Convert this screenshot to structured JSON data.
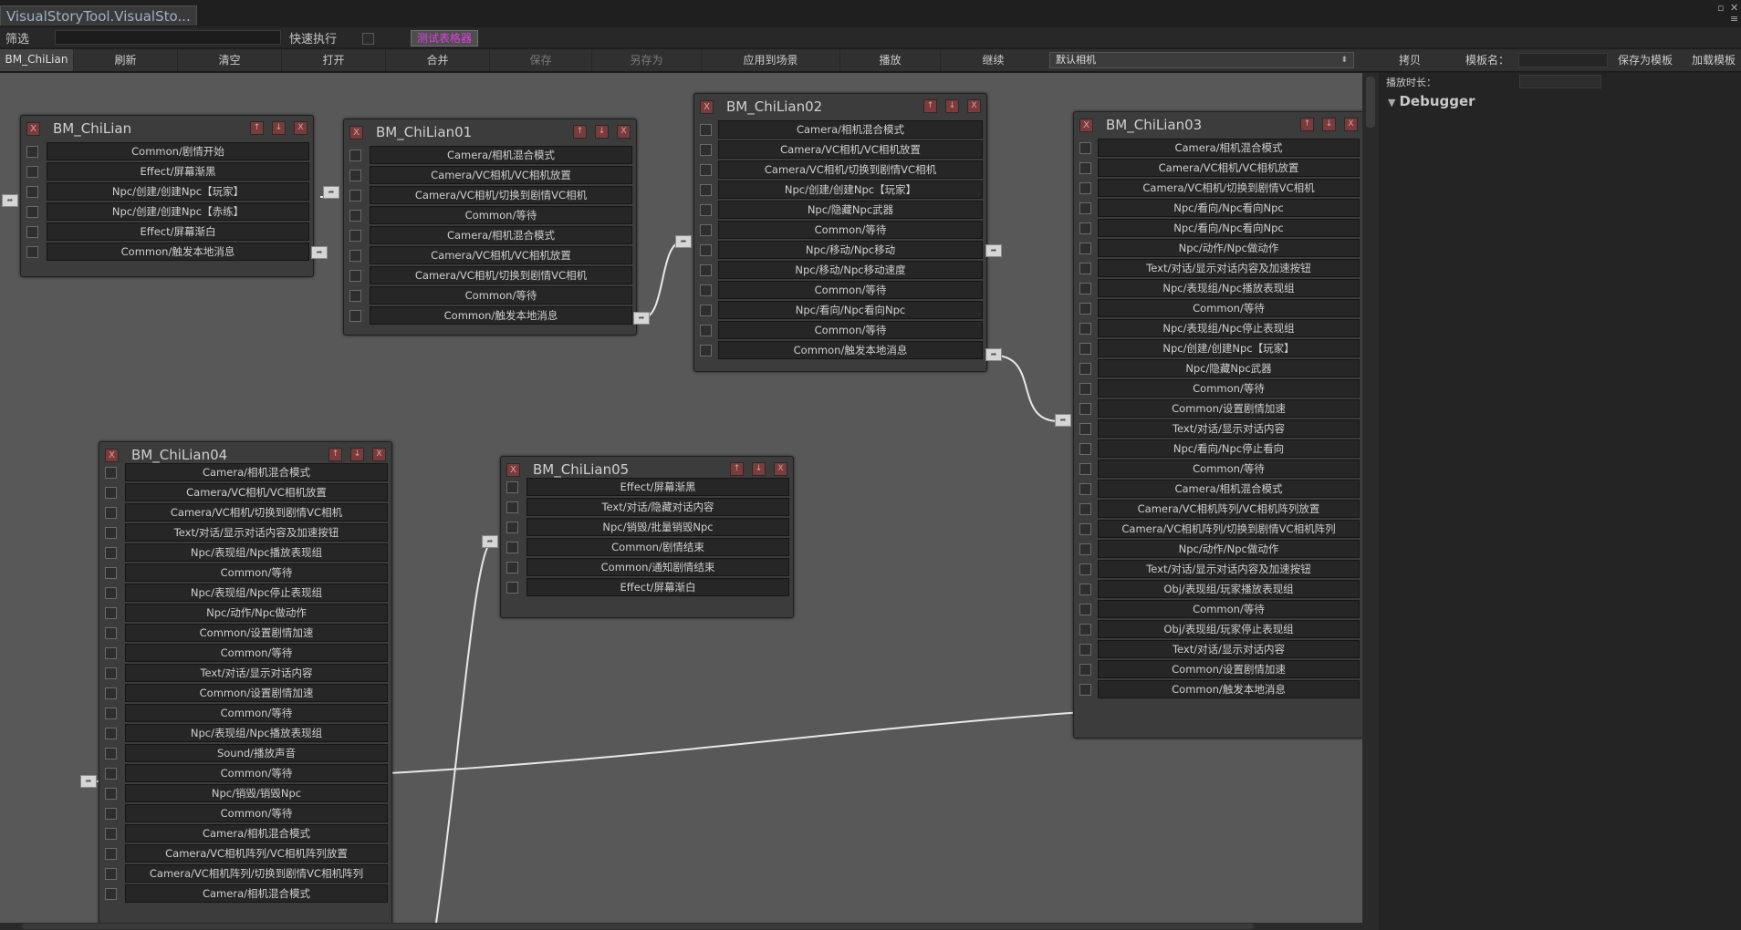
{
  "window": {
    "tab_title": "VisualStoryTool.VisualSto...",
    "controls": [
      "▫",
      "✕",
      "≡"
    ]
  },
  "filterbar": {
    "filter_label": "筛选",
    "quick_exec_label": "快速执行",
    "magenta_button": "测试表格器"
  },
  "toolbar": {
    "active_tab": "BM_ChiLian",
    "buttons": [
      "刷新",
      "清空",
      "打开",
      "合并",
      "保存",
      "另存为",
      "应用到场景",
      "播放",
      "继续"
    ],
    "camera_select": "默认相机",
    "copy_button": "拷贝",
    "template_name_label": "模板名：",
    "save_template_button": "保存为模板",
    "load_template_button": "加载模板"
  },
  "right_panel": {
    "play_duration_label": "播放时长：",
    "debugger_label": "Debugger"
  },
  "nodes": [
    {
      "title": "BM_ChiLian",
      "rows": [
        "Common/剧情开始",
        "Effect/屏幕渐黑",
        "Npc/创建/创建Npc【玩家】",
        "Npc/创建/创建Npc【赤练】",
        "Effect/屏幕渐白",
        "Common/触发本地消息"
      ]
    },
    {
      "title": "BM_ChiLian01",
      "rows": [
        "Camera/相机混合模式",
        "Camera/VC相机/VC相机放置",
        "Camera/VC相机/切换到剧情VC相机",
        "Common/等待",
        "Camera/相机混合模式",
        "Camera/VC相机/VC相机放置",
        "Camera/VC相机/切换到剧情VC相机",
        "Common/等待",
        "Common/触发本地消息"
      ]
    },
    {
      "title": "BM_ChiLian02",
      "rows": [
        "Camera/相机混合模式",
        "Camera/VC相机/VC相机放置",
        "Camera/VC相机/切换到剧情VC相机",
        "Npc/创建/创建Npc【玩家】",
        "Npc/隐藏Npc武器",
        "Common/等待",
        "Npc/移动/Npc移动",
        "Npc/移动/Npc移动速度",
        "Common/等待",
        "Npc/看向/Npc看向Npc",
        "Common/等待",
        "Common/触发本地消息"
      ]
    },
    {
      "title": "BM_ChiLian03",
      "rows": [
        "Camera/相机混合模式",
        "Camera/VC相机/VC相机放置",
        "Camera/VC相机/切换到剧情VC相机",
        "Npc/看向/Npc看向Npc",
        "Npc/看向/Npc看向Npc",
        "Npc/动作/Npc做动作",
        "Text/对话/显示对话内容及加速按钮",
        "Npc/表现组/Npc播放表现组",
        "Common/等待",
        "Npc/表现组/Npc停止表现组",
        "Npc/创建/创建Npc【玩家】",
        "Npc/隐藏Npc武器",
        "Common/等待",
        "Common/设置剧情加速",
        "Text/对话/显示对话内容",
        "Npc/看向/Npc停止看向",
        "Common/等待",
        "Camera/相机混合模式",
        "Camera/VC相机阵列/VC相机阵列放置",
        "Camera/VC相机阵列/切换到剧情VC相机阵列",
        "Npc/动作/Npc做动作",
        "Text/对话/显示对话内容及加速按钮",
        "Obj/表现组/玩家播放表现组",
        "Common/等待",
        "Obj/表现组/玩家停止表现组",
        "Text/对话/显示对话内容",
        "Common/设置剧情加速",
        "Common/触发本地消息"
      ]
    },
    {
      "title": "BM_ChiLian04",
      "rows": [
        "Camera/相机混合模式",
        "Camera/VC相机/VC相机放置",
        "Camera/VC相机/切换到剧情VC相机",
        "Text/对话/显示对话内容及加速按钮",
        "Npc/表现组/Npc播放表现组",
        "Common/等待",
        "Npc/表现组/Npc停止表现组",
        "Npc/动作/Npc做动作",
        "Common/设置剧情加速",
        "Common/等待",
        "Text/对话/显示对话内容",
        "Common/设置剧情加速",
        "Common/等待",
        "Npc/表现组/Npc播放表现组",
        "Sound/播放声音",
        "Common/等待",
        "Npc/销毁/销毁Npc",
        "Common/等待",
        "Camera/相机混合模式",
        "Camera/VC相机阵列/VC相机阵列放置",
        "Camera/VC相机阵列/切换到剧情VC相机阵列",
        "Camera/相机混合模式"
      ]
    },
    {
      "title": "BM_ChiLian05",
      "rows": [
        "Effect/屏幕渐黑",
        "Text/对话/隐藏对话内容",
        "Npc/销毁/批量销毁Npc",
        "Common/剧情结束",
        "Common/通知剧情结束",
        "Effect/屏幕渐白"
      ]
    }
  ],
  "colors": {
    "canvas": "#585858",
    "node_bg": "#3c3c3c",
    "row_bg": "#262626",
    "close_btn": "#7a3b3b",
    "accent_magenta": "#e040e0",
    "wire": "#e8e8e8"
  }
}
